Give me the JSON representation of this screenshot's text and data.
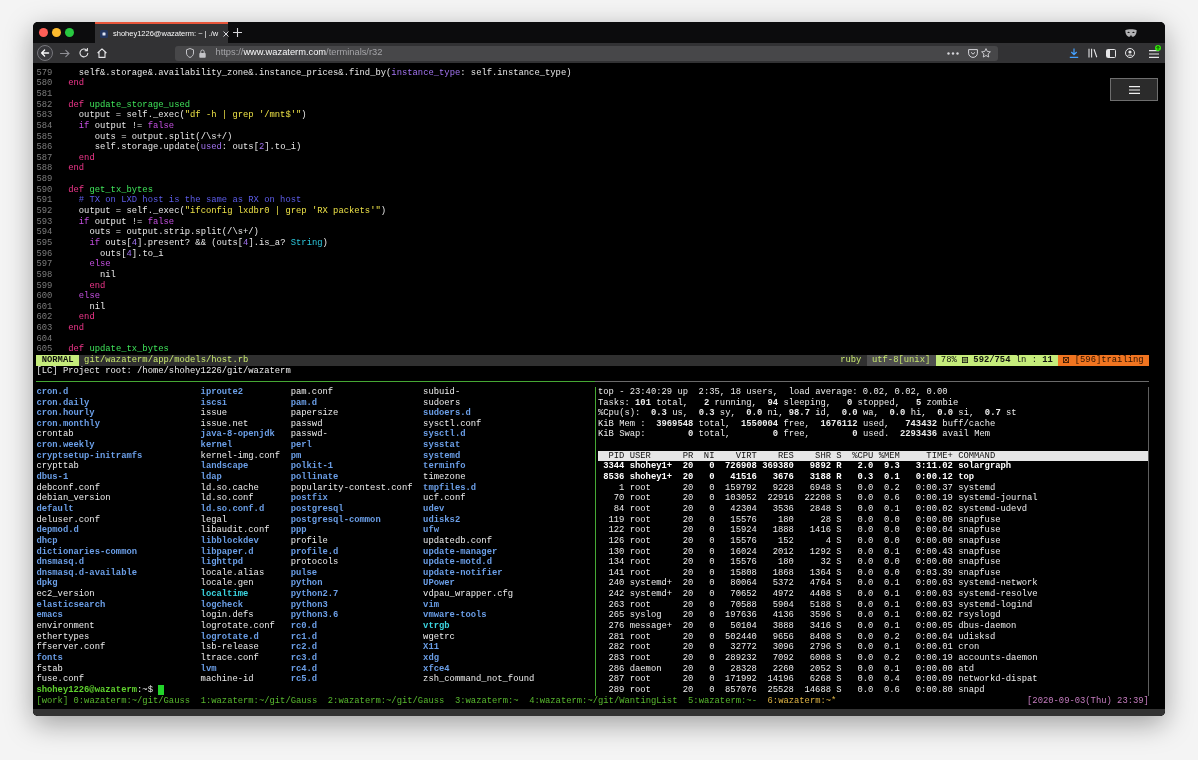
{
  "browser": {
    "tab": {
      "title": "shohey1226@wazaterm: ~ | ./w",
      "selected": true
    },
    "url": {
      "scheme": "https://",
      "host": "www.wazaterm.com",
      "path": "/terminals/r32"
    }
  },
  "editor": {
    "lines": [
      {
        "number": "579",
        "tokens": [
          {
            "text": "    self&.storage&.availability_zone&.instance_prices&.find_by(",
            "kind": "plain"
          },
          {
            "text": "instance_type",
            "kind": "label"
          },
          {
            "text": ": self.instance_type)",
            "kind": "plain"
          }
        ]
      },
      {
        "number": "580",
        "tokens": [
          {
            "text": "  end",
            "kind": "keyword"
          }
        ]
      },
      {
        "number": "581"
      },
      {
        "number": "582",
        "tokens": [
          {
            "text": "  def ",
            "kind": "keyword"
          },
          {
            "text": "update_storage_used",
            "kind": "name"
          }
        ]
      },
      {
        "number": "583",
        "tokens": [
          {
            "text": "    output = self._exec(",
            "kind": "plain"
          },
          {
            "text": "\"df -h | grep '/mnt$'\"",
            "kind": "string"
          },
          {
            "text": ")",
            "kind": "plain"
          }
        ]
      },
      {
        "number": "584",
        "tokens": [
          {
            "text": "    if",
            "kind": "control"
          },
          {
            "text": " output != ",
            "kind": "plain"
          },
          {
            "text": "false",
            "kind": "control"
          }
        ]
      },
      {
        "number": "585",
        "tokens": [
          {
            "text": "       outs = output.split(/\\s+/)",
            "kind": "plain"
          }
        ]
      },
      {
        "number": "586",
        "tokens": [
          {
            "text": "       self.storage.update(",
            "kind": "plain"
          },
          {
            "text": "used",
            "kind": "label"
          },
          {
            "text": ": outs[",
            "kind": "plain"
          },
          {
            "text": "2",
            "kind": "number"
          },
          {
            "text": "].to_i)",
            "kind": "plain"
          }
        ]
      },
      {
        "number": "587",
        "tokens": [
          {
            "text": "    end",
            "kind": "keyword"
          }
        ]
      },
      {
        "number": "588",
        "tokens": [
          {
            "text": "  end",
            "kind": "keyword"
          }
        ]
      },
      {
        "number": "589"
      },
      {
        "number": "590",
        "tokens": [
          {
            "text": "  def ",
            "kind": "keyword"
          },
          {
            "text": "get_tx_bytes",
            "kind": "name"
          }
        ]
      },
      {
        "number": "591",
        "tokens": [
          {
            "text": "    # TX on LXD host is the same as RX on host",
            "kind": "comment"
          }
        ]
      },
      {
        "number": "592",
        "tokens": [
          {
            "text": "    output = self._exec(",
            "kind": "plain"
          },
          {
            "text": "\"ifconfig lxdbr0 | grep 'RX packets'\"",
            "kind": "string"
          },
          {
            "text": ")",
            "kind": "plain"
          }
        ]
      },
      {
        "number": "593",
        "tokens": [
          {
            "text": "    if",
            "kind": "control"
          },
          {
            "text": " output != ",
            "kind": "plain"
          },
          {
            "text": "false",
            "kind": "control"
          }
        ]
      },
      {
        "number": "594",
        "tokens": [
          {
            "text": "      outs = output.strip.split(/\\s+/)",
            "kind": "plain"
          }
        ]
      },
      {
        "number": "595",
        "tokens": [
          {
            "text": "      if",
            "kind": "control"
          },
          {
            "text": " outs[",
            "kind": "plain"
          },
          {
            "text": "4",
            "kind": "number"
          },
          {
            "text": "].present? && (outs[",
            "kind": "plain"
          },
          {
            "text": "4",
            "kind": "number"
          },
          {
            "text": "].is_a? ",
            "kind": "plain"
          },
          {
            "text": "String",
            "kind": "constant"
          },
          {
            "text": ")",
            "kind": "plain"
          }
        ]
      },
      {
        "number": "596",
        "tokens": [
          {
            "text": "        outs[",
            "kind": "plain"
          },
          {
            "text": "4",
            "kind": "number"
          },
          {
            "text": "].to_i",
            "kind": "plain"
          }
        ]
      },
      {
        "number": "597",
        "tokens": [
          {
            "text": "      else",
            "kind": "control"
          }
        ]
      },
      {
        "number": "598",
        "tokens": [
          {
            "text": "        nil",
            "kind": "plain"
          }
        ]
      },
      {
        "number": "599",
        "tokens": [
          {
            "text": "      end",
            "kind": "keyword"
          }
        ]
      },
      {
        "number": "600",
        "tokens": [
          {
            "text": "    else",
            "kind": "control"
          }
        ]
      },
      {
        "number": "601",
        "tokens": [
          {
            "text": "      nil",
            "kind": "plain"
          }
        ]
      },
      {
        "number": "602",
        "tokens": [
          {
            "text": "    end",
            "kind": "keyword"
          }
        ]
      },
      {
        "number": "603",
        "tokens": [
          {
            "text": "  end",
            "kind": "keyword"
          }
        ]
      },
      {
        "number": "604"
      },
      {
        "number": "605",
        "tokens": [
          {
            "text": "  def ",
            "kind": "keyword"
          },
          {
            "text": "update_tx_bytes",
            "kind": "name"
          }
        ]
      }
    ],
    "statusline": {
      "mode": "NORMAL",
      "file": "git/wazaterm/app/models/host.rb",
      "filetype": "ruby",
      "encoding": "utf-8[unix]",
      "percent": "78%",
      "position": "**592/754** ln : **11**",
      "warning": "[596]trailing"
    },
    "message": "[LC] Project root: /home/shohey1226/git/wazaterm"
  },
  "listing": {
    "columns": [
      [
        {
          "name": "cron.d",
          "kind": "dir"
        },
        {
          "name": "cron.daily",
          "kind": "dir"
        },
        {
          "name": "cron.hourly",
          "kind": "dir"
        },
        {
          "name": "cron.monthly",
          "kind": "dir"
        },
        {
          "name": "crontab",
          "kind": "file"
        },
        {
          "name": "cron.weekly",
          "kind": "dir"
        },
        {
          "name": "cryptsetup-initramfs",
          "kind": "dir"
        },
        {
          "name": "crypttab",
          "kind": "file"
        },
        {
          "name": "dbus-1",
          "kind": "dir"
        },
        {
          "name": "debconf.conf",
          "kind": "file"
        },
        {
          "name": "debian_version",
          "kind": "file"
        },
        {
          "name": "default",
          "kind": "dir"
        },
        {
          "name": "deluser.conf",
          "kind": "file"
        },
        {
          "name": "depmod.d",
          "kind": "dir"
        },
        {
          "name": "dhcp",
          "kind": "dir"
        },
        {
          "name": "dictionaries-common",
          "kind": "dir"
        },
        {
          "name": "dnsmasq.d",
          "kind": "dir"
        },
        {
          "name": "dnsmasq.d-available",
          "kind": "dir"
        },
        {
          "name": "dpkg",
          "kind": "dir"
        },
        {
          "name": "ec2_version",
          "kind": "file"
        },
        {
          "name": "elasticsearch",
          "kind": "dir"
        },
        {
          "name": "emacs",
          "kind": "dir"
        },
        {
          "name": "environment",
          "kind": "file"
        },
        {
          "name": "ethertypes",
          "kind": "file"
        },
        {
          "name": "ffserver.conf",
          "kind": "file"
        },
        {
          "name": "fonts",
          "kind": "dir"
        },
        {
          "name": "fstab",
          "kind": "file"
        },
        {
          "name": "fuse.conf",
          "kind": "file"
        }
      ],
      [
        {
          "name": "iproute2",
          "kind": "dir"
        },
        {
          "name": "iscsi",
          "kind": "dir"
        },
        {
          "name": "issue",
          "kind": "file"
        },
        {
          "name": "issue.net",
          "kind": "file"
        },
        {
          "name": "java-8-openjdk",
          "kind": "dir"
        },
        {
          "name": "kernel",
          "kind": "dir"
        },
        {
          "name": "kernel-img.conf",
          "kind": "file"
        },
        {
          "name": "landscape",
          "kind": "dir"
        },
        {
          "name": "ldap",
          "kind": "dir"
        },
        {
          "name": "ld.so.cache",
          "kind": "file"
        },
        {
          "name": "ld.so.conf",
          "kind": "file"
        },
        {
          "name": "ld.so.conf.d",
          "kind": "dir"
        },
        {
          "name": "legal",
          "kind": "file"
        },
        {
          "name": "libaudit.conf",
          "kind": "file"
        },
        {
          "name": "libblockdev",
          "kind": "dir"
        },
        {
          "name": "libpaper.d",
          "kind": "dir"
        },
        {
          "name": "lighttpd",
          "kind": "dir"
        },
        {
          "name": "locale.alias",
          "kind": "file"
        },
        {
          "name": "locale.gen",
          "kind": "file"
        },
        {
          "name": "localtime",
          "kind": "link"
        },
        {
          "name": "logcheck",
          "kind": "dir"
        },
        {
          "name": "login.defs",
          "kind": "file"
        },
        {
          "name": "logrotate.conf",
          "kind": "file"
        },
        {
          "name": "logrotate.d",
          "kind": "dir"
        },
        {
          "name": "lsb-release",
          "kind": "file"
        },
        {
          "name": "ltrace.conf",
          "kind": "file"
        },
        {
          "name": "lvm",
          "kind": "dir"
        },
        {
          "name": "machine-id",
          "kind": "file"
        }
      ],
      [
        {
          "name": "pam.conf",
          "kind": "file"
        },
        {
          "name": "pam.d",
          "kind": "dir"
        },
        {
          "name": "papersize",
          "kind": "file"
        },
        {
          "name": "passwd",
          "kind": "file"
        },
        {
          "name": "passwd-",
          "kind": "file"
        },
        {
          "name": "perl",
          "kind": "dir"
        },
        {
          "name": "pm",
          "kind": "dir"
        },
        {
          "name": "polkit-1",
          "kind": "dir"
        },
        {
          "name": "pollinate",
          "kind": "dir"
        },
        {
          "name": "popularity-contest.conf",
          "kind": "file"
        },
        {
          "name": "postfix",
          "kind": "dir"
        },
        {
          "name": "postgresql",
          "kind": "dir"
        },
        {
          "name": "postgresql-common",
          "kind": "dir"
        },
        {
          "name": "ppp",
          "kind": "dir"
        },
        {
          "name": "profile",
          "kind": "file"
        },
        {
          "name": "profile.d",
          "kind": "dir"
        },
        {
          "name": "protocols",
          "kind": "file"
        },
        {
          "name": "pulse",
          "kind": "dir"
        },
        {
          "name": "python",
          "kind": "dir"
        },
        {
          "name": "python2.7",
          "kind": "dir"
        },
        {
          "name": "python3",
          "kind": "dir"
        },
        {
          "name": "python3.6",
          "kind": "dir"
        },
        {
          "name": "rc0.d",
          "kind": "dir"
        },
        {
          "name": "rc1.d",
          "kind": "dir"
        },
        {
          "name": "rc2.d",
          "kind": "dir"
        },
        {
          "name": "rc3.d",
          "kind": "dir"
        },
        {
          "name": "rc4.d",
          "kind": "dir"
        },
        {
          "name": "rc5.d",
          "kind": "dir"
        }
      ],
      [
        {
          "name": "subuid-",
          "kind": "file"
        },
        {
          "name": "sudoers",
          "kind": "file"
        },
        {
          "name": "sudoers.d",
          "kind": "dir"
        },
        {
          "name": "sysctl.conf",
          "kind": "file"
        },
        {
          "name": "sysctl.d",
          "kind": "dir"
        },
        {
          "name": "sysstat",
          "kind": "dir"
        },
        {
          "name": "systemd",
          "kind": "dir"
        },
        {
          "name": "terminfo",
          "kind": "dir"
        },
        {
          "name": "timezone",
          "kind": "file"
        },
        {
          "name": "tmpfiles.d",
          "kind": "dir"
        },
        {
          "name": "ucf.conf",
          "kind": "file"
        },
        {
          "name": "udev",
          "kind": "dir"
        },
        {
          "name": "udisks2",
          "kind": "dir"
        },
        {
          "name": "ufw",
          "kind": "dir"
        },
        {
          "name": "updatedb.conf",
          "kind": "file"
        },
        {
          "name": "update-manager",
          "kind": "dir"
        },
        {
          "name": "update-motd.d",
          "kind": "dir"
        },
        {
          "name": "update-notifier",
          "kind": "dir"
        },
        {
          "name": "UPower",
          "kind": "dir"
        },
        {
          "name": "vdpau_wrapper.cfg",
          "kind": "file"
        },
        {
          "name": "vim",
          "kind": "dir"
        },
        {
          "name": "vmware-tools",
          "kind": "dir"
        },
        {
          "name": "vtrgb",
          "kind": "link"
        },
        {
          "name": "wgetrc",
          "kind": "file"
        },
        {
          "name": "X11",
          "kind": "dir"
        },
        {
          "name": "xdg",
          "kind": "dir"
        },
        {
          "name": "xfce4",
          "kind": "dir"
        },
        {
          "name": "zsh_command_not_found",
          "kind": "file"
        }
      ]
    ],
    "prompt": {
      "user_host": "shohey1226@wazaterm",
      "path": ":~$"
    }
  },
  "top": {
    "summary": [
      "top - 23:40:29 up  2:35, 18 users,  load average: 0.02, 0.02, 0.00",
      "Tasks: **101** total,   **2** running,  **94** sleeping,   **0** stopped,   **5** zombie",
      "%Cpu(s):  **0.3** us,  **0.3** sy,  **0.0** ni, **98.7** id,  **0.0** wa,  **0.0** hi,  **0.0** si,  **0.7** st",
      "KiB Mem :  **3969548** total,  **1550004** free,  **1676112** used,   **743432** buff/cache",
      "KiB Swap:        **0** total,        **0** free,        **0** used.  **2293436** avail Mem"
    ],
    "columns": [
      "PID",
      "USER",
      "PR",
      "NI",
      "VIRT",
      "RES",
      "SHR",
      "S",
      "%CPU",
      "%MEM",
      "TIME+",
      "COMMAND"
    ],
    "processes": [
      {
        "cells": [
          "3344",
          "shohey1+",
          "20",
          "0",
          "726908",
          "369380",
          "9892",
          "R",
          "2.0",
          "9.3",
          "3:11.02",
          "solargraph"
        ],
        "highlighted": true
      },
      {
        "cells": [
          "8536",
          "shohey1+",
          "20",
          "0",
          "41516",
          "3676",
          "3188",
          "R",
          "0.3",
          "0.1",
          "0:00.12",
          "top"
        ],
        "highlighted": true
      },
      {
        "cells": [
          "1",
          "root",
          "20",
          "0",
          "159792",
          "9228",
          "6948",
          "S",
          "0.0",
          "0.2",
          "0:00.37",
          "systemd"
        ],
        "highlighted": false
      },
      {
        "cells": [
          "70",
          "root",
          "20",
          "0",
          "103052",
          "22916",
          "22208",
          "S",
          "0.0",
          "0.6",
          "0:00.19",
          "systemd-journal"
        ],
        "highlighted": false
      },
      {
        "cells": [
          "84",
          "root",
          "20",
          "0",
          "42304",
          "3536",
          "2848",
          "S",
          "0.0",
          "0.1",
          "0:00.02",
          "systemd-udevd"
        ],
        "highlighted": false
      },
      {
        "cells": [
          "119",
          "root",
          "20",
          "0",
          "15576",
          "180",
          "28",
          "S",
          "0.0",
          "0.0",
          "0:00.00",
          "snapfuse"
        ],
        "highlighted": false
      },
      {
        "cells": [
          "122",
          "root",
          "20",
          "0",
          "15924",
          "1888",
          "1416",
          "S",
          "0.0",
          "0.0",
          "0:00.04",
          "snapfuse"
        ],
        "highlighted": false
      },
      {
        "cells": [
          "126",
          "root",
          "20",
          "0",
          "15576",
          "152",
          "4",
          "S",
          "0.0",
          "0.0",
          "0:00.00",
          "snapfuse"
        ],
        "highlighted": false
      },
      {
        "cells": [
          "130",
          "root",
          "20",
          "0",
          "16024",
          "2012",
          "1292",
          "S",
          "0.0",
          "0.1",
          "0:00.43",
          "snapfuse"
        ],
        "highlighted": false
      },
      {
        "cells": [
          "134",
          "root",
          "20",
          "0",
          "15576",
          "180",
          "32",
          "S",
          "0.0",
          "0.0",
          "0:00.00",
          "snapfuse"
        ],
        "highlighted": false
      },
      {
        "cells": [
          "141",
          "root",
          "20",
          "0",
          "15808",
          "1868",
          "1364",
          "S",
          "0.0",
          "0.0",
          "0:03.39",
          "snapfuse"
        ],
        "highlighted": false
      },
      {
        "cells": [
          "240",
          "systemd+",
          "20",
          "0",
          "80064",
          "5372",
          "4764",
          "S",
          "0.0",
          "0.1",
          "0:00.03",
          "systemd-network"
        ],
        "highlighted": false
      },
      {
        "cells": [
          "242",
          "systemd+",
          "20",
          "0",
          "70652",
          "4972",
          "4408",
          "S",
          "0.0",
          "0.1",
          "0:00.03",
          "systemd-resolve"
        ],
        "highlighted": false
      },
      {
        "cells": [
          "263",
          "root",
          "20",
          "0",
          "70588",
          "5904",
          "5188",
          "S",
          "0.0",
          "0.1",
          "0:00.03",
          "systemd-logind"
        ],
        "highlighted": false
      },
      {
        "cells": [
          "265",
          "syslog",
          "20",
          "0",
          "197636",
          "4136",
          "3596",
          "S",
          "0.0",
          "0.1",
          "0:00.02",
          "rsyslogd"
        ],
        "highlighted": false
      },
      {
        "cells": [
          "276",
          "message+",
          "20",
          "0",
          "50104",
          "3888",
          "3416",
          "S",
          "0.0",
          "0.1",
          "0:00.05",
          "dbus-daemon"
        ],
        "highlighted": false
      },
      {
        "cells": [
          "281",
          "root",
          "20",
          "0",
          "502440",
          "9656",
          "8408",
          "S",
          "0.0",
          "0.2",
          "0:00.04",
          "udisksd"
        ],
        "highlighted": false
      },
      {
        "cells": [
          "282",
          "root",
          "20",
          "0",
          "32772",
          "3096",
          "2796",
          "S",
          "0.0",
          "0.1",
          "0:00.01",
          "cron"
        ],
        "highlighted": false
      },
      {
        "cells": [
          "283",
          "root",
          "20",
          "0",
          "289232",
          "7092",
          "6008",
          "S",
          "0.0",
          "0.2",
          "0:00.19",
          "accounts-daemon"
        ],
        "highlighted": false
      },
      {
        "cells": [
          "286",
          "daemon",
          "20",
          "0",
          "28328",
          "2260",
          "2052",
          "S",
          "0.0",
          "0.1",
          "0:00.00",
          "atd"
        ],
        "highlighted": false
      },
      {
        "cells": [
          "287",
          "root",
          "20",
          "0",
          "171992",
          "14196",
          "6268",
          "S",
          "0.0",
          "0.4",
          "0:00.09",
          "networkd-dispat"
        ],
        "highlighted": false
      },
      {
        "cells": [
          "289",
          "root",
          "20",
          "0",
          "857076",
          "25528",
          "14688",
          "S",
          "0.0",
          "0.6",
          "0:00.80",
          "snapd"
        ],
        "highlighted": false
      }
    ]
  },
  "tmux": {
    "session": "[work]",
    "windows": [
      {
        "label": "0:wazaterm:~/git/Gauss",
        "selected": false
      },
      {
        "label": "1:wazaterm:~/git/Gauss",
        "selected": false
      },
      {
        "label": "2:wazaterm:~/git/Gauss",
        "selected": false
      },
      {
        "label": "3:wazaterm:~",
        "selected": false
      },
      {
        "label": "4:wazaterm:~/git/WantingList",
        "selected": false
      },
      {
        "label": "5:wazaterm:~-",
        "selected": false
      },
      {
        "label": "6:wazaterm:~*",
        "selected": true
      }
    ],
    "clock": "[2020-09-03(Thu) 23:39]"
  }
}
